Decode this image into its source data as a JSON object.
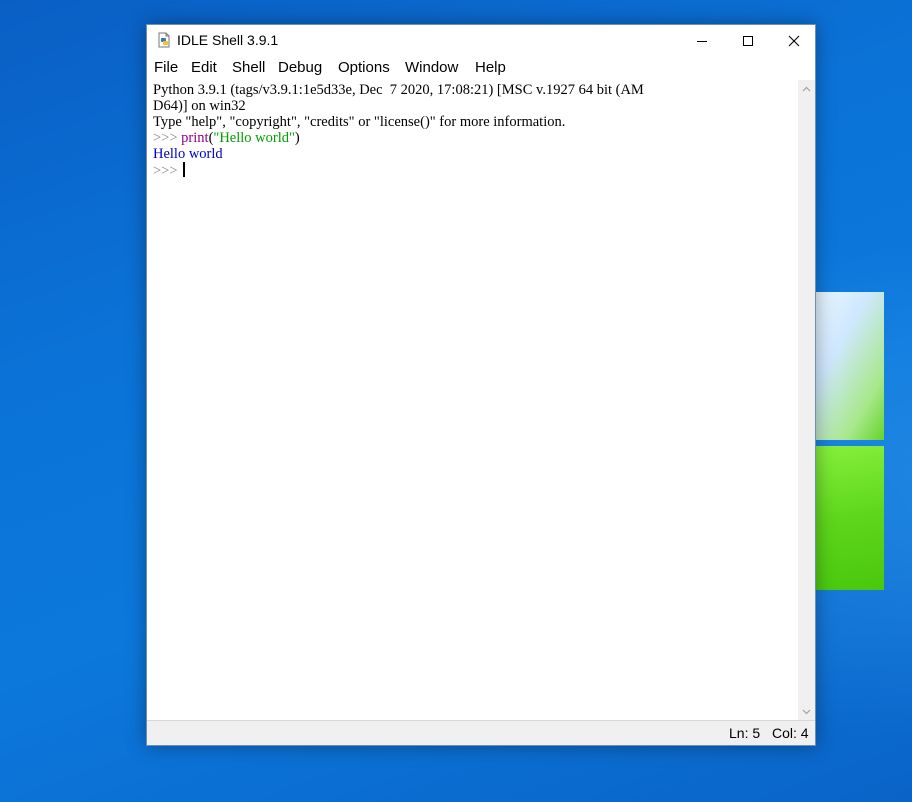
{
  "desktop": {
    "accent": "#0b73d8"
  },
  "window": {
    "title": "IDLE Shell 3.9.1",
    "controls": {
      "minimize": "minimize-icon",
      "maximize": "maximize-icon",
      "close": "close-icon"
    }
  },
  "menu": {
    "items": [
      "File",
      "Edit",
      "Shell",
      "Debug",
      "Options",
      "Window",
      "Help"
    ]
  },
  "shell": {
    "banner_line1": "Python 3.9.1 (tags/v3.9.1:1e5d33e, Dec  7 2020, 17:08:21) [MSC v.1927 64 bit (AM",
    "banner_line2": "D64)] on win32",
    "banner_line3": "Type \"help\", \"copyright\", \"credits\" or \"license()\" for more information.",
    "prompt": ">>> ",
    "command_keyword": "print",
    "command_open": "(",
    "command_string": "\"Hello world\"",
    "command_close": ")",
    "output": "Hello world",
    "colors": {
      "keyword": "#900090",
      "string": "#00a000",
      "output": "#0000c8",
      "prompt": "#8a8a8a"
    }
  },
  "status": {
    "line": "Ln: 5",
    "col": "Col: 4"
  }
}
